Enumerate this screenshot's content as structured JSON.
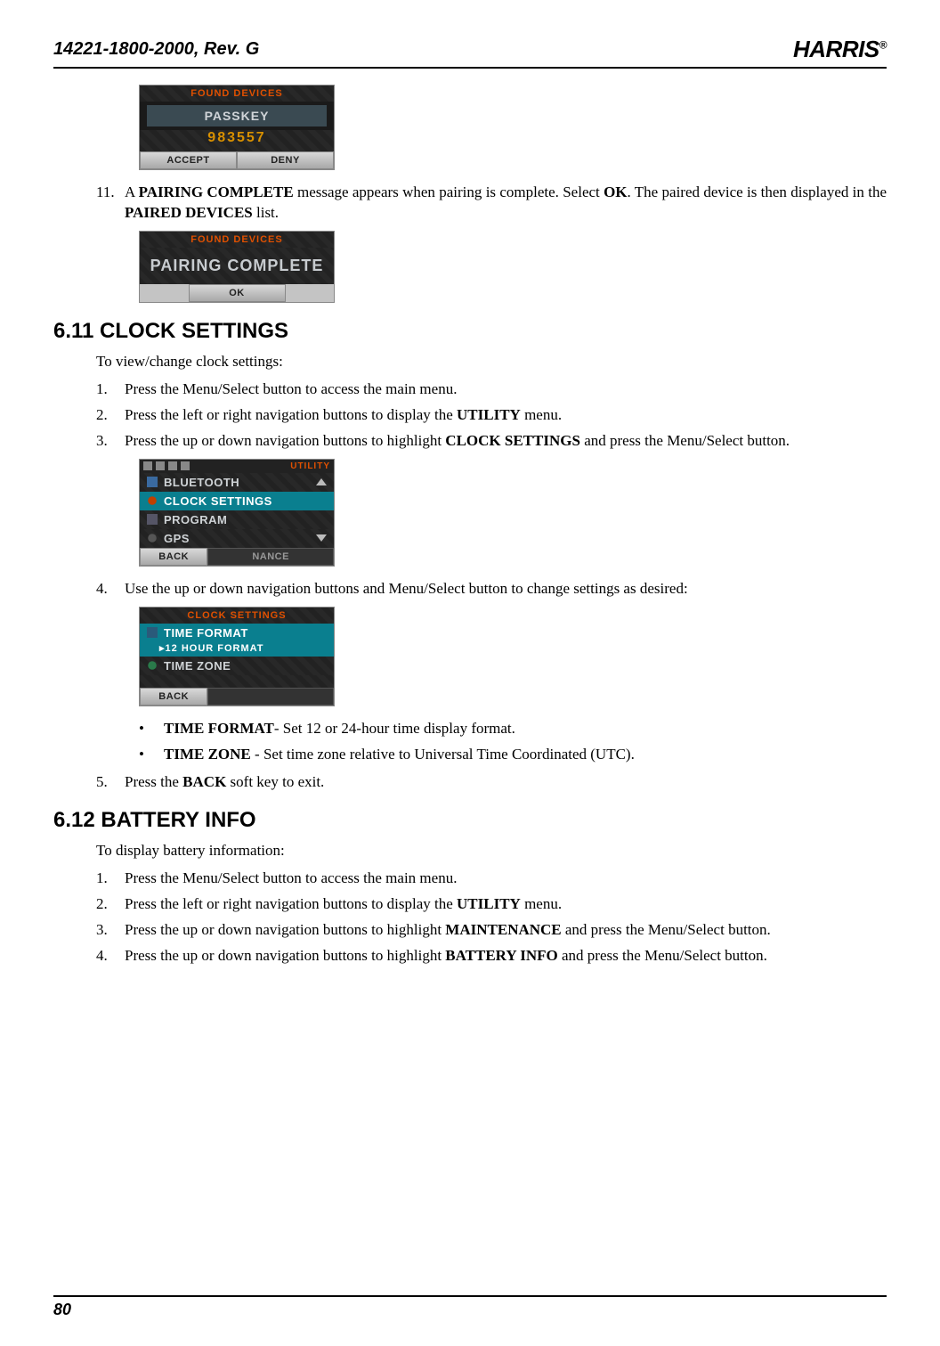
{
  "header": {
    "doc_id": "14221-1800-2000, Rev. G",
    "logo": "HARRIS",
    "logo_r": "®"
  },
  "screenshot_passkey": {
    "title": "FOUND DEVICES",
    "label": "PASSKEY",
    "value": "983557",
    "softkeys": [
      "ACCEPT",
      "DENY"
    ]
  },
  "step11": {
    "num": "11.",
    "pre": "A ",
    "bold1": "PAIRING COMPLETE",
    "mid1": " message appears when pairing is complete. Select ",
    "bold2": "OK",
    "mid2": ".  The paired device is then displayed in the ",
    "bold3": "PAIRED DEVICES",
    "post": " list."
  },
  "screenshot_complete": {
    "title": "FOUND DEVICES",
    "message": "PAIRING COMPLETE",
    "softkey": "OK"
  },
  "section_611": {
    "heading": "6.11  CLOCK SETTINGS",
    "intro": "To view/change clock settings:",
    "steps": [
      {
        "num": "1.",
        "pre": "Press the Menu/Select button to access the main menu."
      },
      {
        "num": "2.",
        "pre": "Press the left or right navigation buttons to display the ",
        "b1": "UTILITY",
        "post": " menu."
      },
      {
        "num": "3.",
        "pre": "Press the up or down navigation buttons to highlight ",
        "b1": "CLOCK SETTINGS",
        "post": " and press the Menu/Select button."
      }
    ],
    "screenshot_menu": {
      "tab": "UTILITY",
      "items": [
        "BLUETOOTH",
        "CLOCK SETTINGS",
        "PROGRAM",
        "GPS"
      ],
      "selected_index": 1,
      "softkey": "BACK",
      "softkey_right": "NANCE"
    },
    "step4": {
      "num": "4.",
      "text": "Use the up or down navigation buttons and Menu/Select button to change settings as desired:"
    },
    "screenshot_clock": {
      "title": "CLOCK SETTINGS",
      "items": [
        "TIME FORMAT",
        "TIME ZONE"
      ],
      "sub": "▸12 HOUR FORMAT",
      "softkey": "BACK"
    },
    "bullets": [
      {
        "b": "TIME FORMAT",
        "rest": "- Set 12 or 24-hour time display format."
      },
      {
        "b": "TIME ZONE",
        "rest": " - Set time zone relative to Universal Time Coordinated (UTC)."
      }
    ],
    "step5": {
      "num": "5.",
      "pre": "Press the ",
      "b1": "BACK",
      "post": " soft key to exit."
    }
  },
  "section_612": {
    "heading": "6.12  BATTERY INFO",
    "intro": "To display battery information:",
    "steps": [
      {
        "num": "1.",
        "pre": "Press the Menu/Select button to access the main menu."
      },
      {
        "num": "2.",
        "pre": "Press the left or right navigation buttons to display the ",
        "b1": "UTILITY",
        "post": " menu."
      },
      {
        "num": "3.",
        "pre": "Press the up or down navigation buttons to highlight ",
        "b1": "MAINTENANCE",
        "post": " and press the Menu/Select button."
      },
      {
        "num": "4.",
        "pre": "Press the up or down navigation buttons to highlight ",
        "b1": "BATTERY INFO",
        "post": " and press the Menu/Select button."
      }
    ]
  },
  "footer": {
    "page": "80"
  }
}
